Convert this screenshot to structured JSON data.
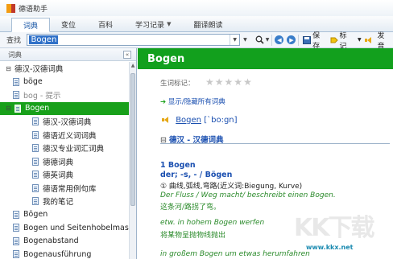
{
  "app": {
    "title": "德语助手"
  },
  "tabs": [
    {
      "label": "词典",
      "active": true,
      "caret": false
    },
    {
      "label": "变位",
      "active": false,
      "caret": false
    },
    {
      "label": "百科",
      "active": false,
      "caret": false
    },
    {
      "label": "学习记录",
      "active": false,
      "caret": true
    },
    {
      "label": "翻译朗读",
      "active": false,
      "caret": false
    }
  ],
  "toolbar": {
    "search_label": "查找",
    "search_value": "Bogen",
    "save_label": "保存",
    "tag_label": "标记",
    "speak_label": "发音"
  },
  "sidebar": {
    "header": "词典",
    "items": [
      {
        "label": "德汉-汉德词典",
        "level": 0,
        "expander": "⊟",
        "icon": false
      },
      {
        "label": "böge",
        "level": 1,
        "icon": true
      },
      {
        "label": "bog - 提示",
        "level": 1,
        "icon": true,
        "dim": true
      },
      {
        "label": "Bogen",
        "level": 0,
        "expander": "⊟",
        "icon": true,
        "selected": true
      },
      {
        "label": "德汉-汉德词典",
        "level": 2,
        "icon": true
      },
      {
        "label": "德语近义词词典",
        "level": 2,
        "icon": true
      },
      {
        "label": "德汉专业词汇词典",
        "level": 2,
        "icon": true
      },
      {
        "label": "德德词典",
        "level": 2,
        "icon": true
      },
      {
        "label": "德英词典",
        "level": 2,
        "icon": true
      },
      {
        "label": "德语常用例句库",
        "level": 2,
        "icon": true
      },
      {
        "label": "我的笔记",
        "level": 2,
        "icon": true
      },
      {
        "label": "Bögen",
        "level": 1,
        "icon": true
      },
      {
        "label": "Bogen und Seitenhobelmas",
        "level": 1,
        "icon": true
      },
      {
        "label": "Bogenabstand",
        "level": 1,
        "icon": true
      },
      {
        "label": "Bogenausführung",
        "level": 1,
        "icon": true
      }
    ]
  },
  "content": {
    "headword": "Bogen",
    "rating_label": "生词标记：",
    "rating_stars": 5,
    "rating_value": 0,
    "toggle_link": "显示/隐藏所有词典",
    "pron_word": "Bogen",
    "pron_ipa": "[ˋbo:gn]",
    "dict_section": "德汉 - 汉德词典",
    "entry_number": "1 Bogen",
    "entry_grammar": "der; -s, - / Bögen",
    "sense_1": "① 曲线,弧线,弯路(近义词:Biegung, Kurve)",
    "ex1_de": "Der Fluss / Weg macht/ beschreibt einen Bogen.",
    "ex1_cn": "这条河/路拐了弯。",
    "ex2_de": "etw. in hohem Bogen werfen",
    "ex2_cn": "将某物呈抛物线抛出",
    "ex3_de": "in großem Bogen um etwas herumfahren"
  },
  "watermark": {
    "brand": "KK下载",
    "url": "www.kkx.net"
  }
}
